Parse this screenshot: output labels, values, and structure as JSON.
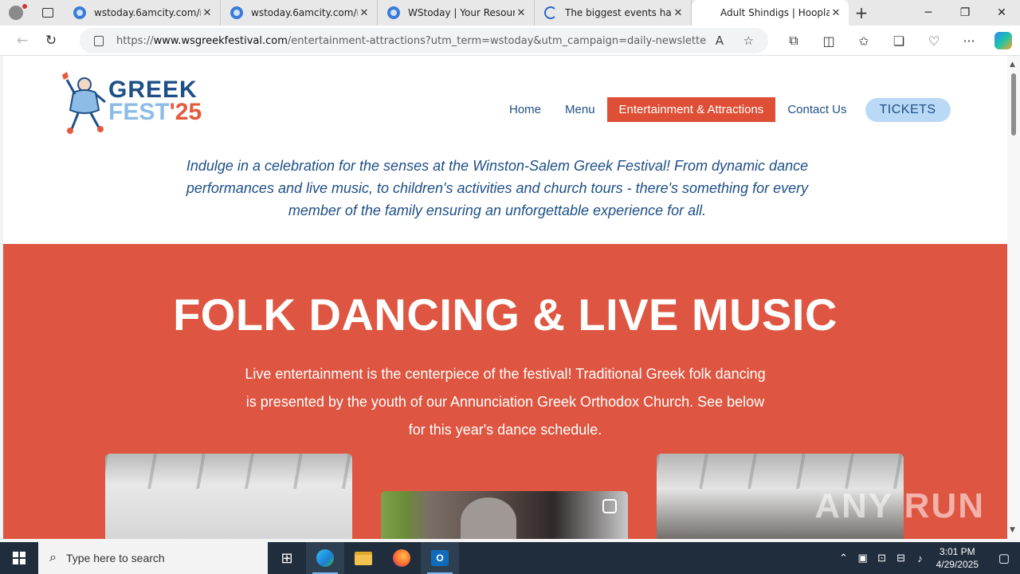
{
  "browser": {
    "tabs": [
      {
        "title": "wstoday.6amcity.com/n",
        "active": false
      },
      {
        "title": "wstoday.6amcity.com/n",
        "active": false
      },
      {
        "title": "WStoday | Your Resource",
        "active": false
      },
      {
        "title": "The biggest events happ",
        "active": false
      },
      {
        "title": "Adult Shindigs | Hoopla",
        "active": true
      }
    ],
    "url_prefix": "https://",
    "url_domain": "www.wsgreekfestival.com",
    "url_path": "/entertainment-attractions?utm_term=wstoday&utm_campaign=daily-newsletter&u..."
  },
  "site": {
    "logo_line1": "GREEK",
    "logo_line2": "FEST",
    "logo_year": "'25",
    "nav": {
      "home": "Home",
      "menu": "Menu",
      "entertainment": "Entertainment & Attractions",
      "contact": "Contact Us",
      "tickets": "TICKETS"
    },
    "intro": "Indulge in a celebration for the senses at the Winston-Salem Greek Festival! From dynamic dance performances and live music, to children's activities and church tours - there's something for every member of the family ensuring an unforgettable experience for all.",
    "section_title": "FOLK DANCING & LIVE MUSIC",
    "section_text": "Live entertainment is the centerpiece of the festival! Traditional Greek folk dancing is presented by the youth of our Annunciation Greek Orthodox Church. See below for this year's dance schedule."
  },
  "watermark": "ANY RUN",
  "taskbar": {
    "search_placeholder": "Type here to search",
    "time": "3:01 PM",
    "date": "4/29/2025"
  },
  "colors": {
    "brand_blue": "#1e4f86",
    "brand_red": "#de5641",
    "tickets_bg": "#bad9f6"
  }
}
